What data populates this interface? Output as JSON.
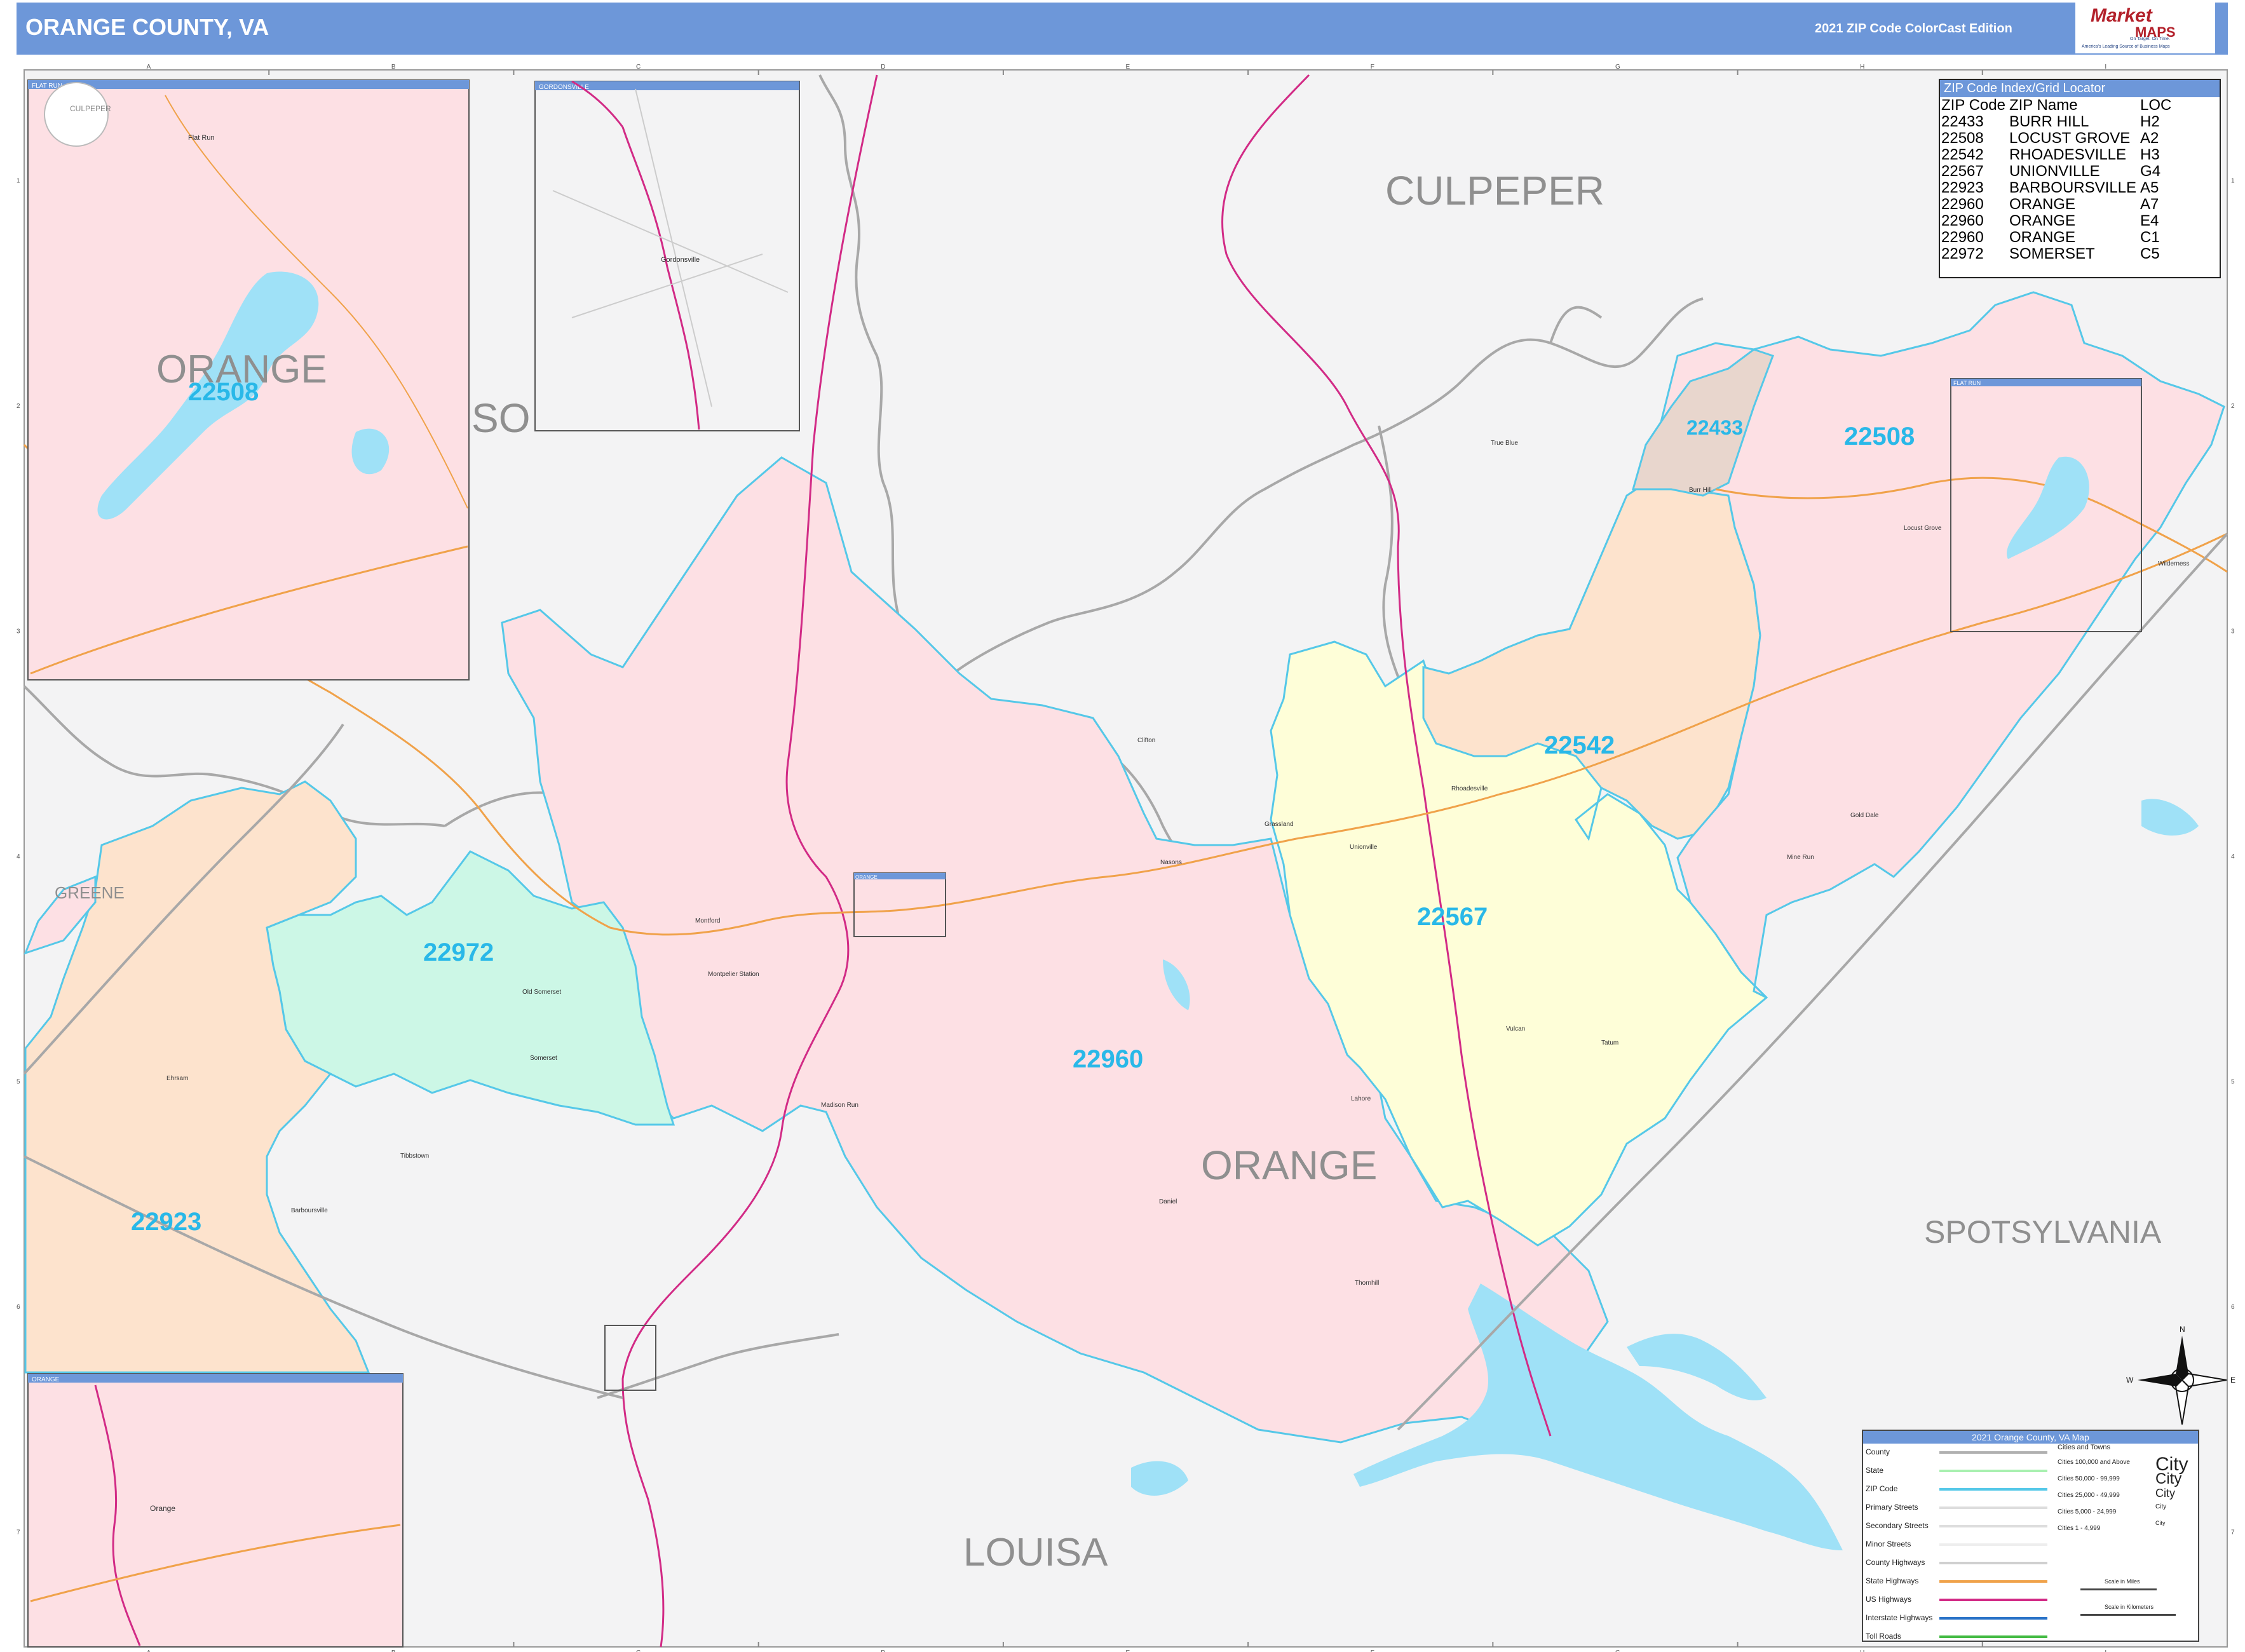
{
  "header": {
    "title": "ORANGE COUNTY, VA",
    "edition": "2021 ZIP Code ColorCast Edition"
  },
  "logo": {
    "brand": "Market",
    "sub": "MAPS",
    "tagline1": "On Target. On Time.",
    "tagline2": "America's Leading Source of Business Maps"
  },
  "grid": {
    "columns": [
      "A",
      "B",
      "C",
      "D",
      "E",
      "F",
      "G",
      "H",
      "I"
    ],
    "rows": [
      "1",
      "2",
      "3",
      "4",
      "5",
      "6",
      "7"
    ]
  },
  "counties": {
    "culpeper": "CULPEPER",
    "spotsylvania": "SPOTSYLVANIA",
    "louisa": "LOUISA",
    "greene": "GREENE",
    "orange": "ORANGE",
    "somerset_partial": "SO",
    "culpeper_small": "CULPEPER"
  },
  "zip_labels": {
    "z22960": "22960",
    "z22567": "22567",
    "z22542": "22542",
    "z22508": "22508",
    "z22433": "22433",
    "z22972": "22972",
    "z22923": "22923",
    "inset_22508": "22508",
    "inset_orange": "ORANGE"
  },
  "places": {
    "true_blue": "True Blue",
    "burr_hill": "Burr Hill",
    "locust_grove": "Locust Grove",
    "wilderness": "Wilderness",
    "clifton": "Clifton",
    "rhoadesville": "Rhoadesville",
    "gold_dale": "Gold Dale",
    "mine_run": "Mine Run",
    "grasslands": "Grassland",
    "unionville": "Unionville",
    "nasons": "Nasons",
    "montford": "Montford",
    "montpelier_station": "Montpelier Station",
    "old_somerset": "Old Somerset",
    "somerset": "Somerset",
    "madison_run": "Madison Run",
    "lahore": "Lahore",
    "vulcan": "Vulcan",
    "tatum": "Tatum",
    "daniel": "Daniel",
    "thornhill": "Thornhill",
    "ehrsam": "Ehrsam",
    "tibbstown": "Tibbstown",
    "barboursville": "Barboursville",
    "gordonsville": "Gordonsville",
    "flat_run": "Flat Run",
    "culpeper_inset": "CULPEPER",
    "orange_town": "Orange"
  },
  "insets": {
    "flat_run_big": "FLAT RUN",
    "gordonsville": "GORDONSVILLE",
    "orange_small": "ORANGE",
    "flat_run_small": "FLAT RUN",
    "orange_box": "ORANGE"
  },
  "zip_index": {
    "title": "ZIP Code Index/Grid Locator",
    "headers": [
      "ZIP Code",
      "ZIP Name",
      "LOC"
    ],
    "rows": [
      [
        "22433",
        "BURR HILL",
        "H2"
      ],
      [
        "22508",
        "LOCUST GROVE",
        "A2"
      ],
      [
        "22542",
        "RHOADESVILLE",
        "H3"
      ],
      [
        "22567",
        "UNIONVILLE",
        "G4"
      ],
      [
        "22923",
        "BARBOURSVILLE",
        "A5"
      ],
      [
        "22960",
        "ORANGE",
        "A7"
      ],
      [
        "22960",
        "ORANGE",
        "E4"
      ],
      [
        "22960",
        "ORANGE",
        "C1"
      ],
      [
        "22972",
        "SOMERSET",
        "C5"
      ]
    ]
  },
  "legend": {
    "title": "2021 Orange County, VA Map",
    "left_items": [
      "County",
      "State",
      "ZIP Code",
      "Primary Streets",
      "Secondary Streets",
      "Minor Streets",
      "County Highways",
      "State Highways",
      "US Highways",
      "Interstate Highways",
      "Toll Roads"
    ],
    "right_title": "Cities and Towns",
    "right_items": [
      "Cities 100,000 and Above",
      "Cities 50,000 - 99,999",
      "Cities 25,000 - 49,999",
      "Cities 5,000 - 24,999",
      "Cities 1 - 4,999"
    ],
    "right_samples": [
      "City",
      "City",
      "City",
      "City",
      "City"
    ],
    "scale_miles": "Scale in Miles",
    "scale_km": "Scale in Kilometers"
  },
  "compass": {
    "n": "N",
    "s": "S",
    "e": "E",
    "w": "W"
  },
  "colors": {
    "header": "#6d97d9",
    "pink": "#fde0e4",
    "peach": "#fde3cd",
    "yellow": "#fefed8",
    "mint": "#ccf7e6",
    "tan": "#e8d6cd",
    "gray": "#f3f3f4",
    "zip_border": "#55c8e8",
    "water": "#9fe1f7",
    "zip_text": "#29b8e8",
    "county_text": "#8f8f8f"
  }
}
